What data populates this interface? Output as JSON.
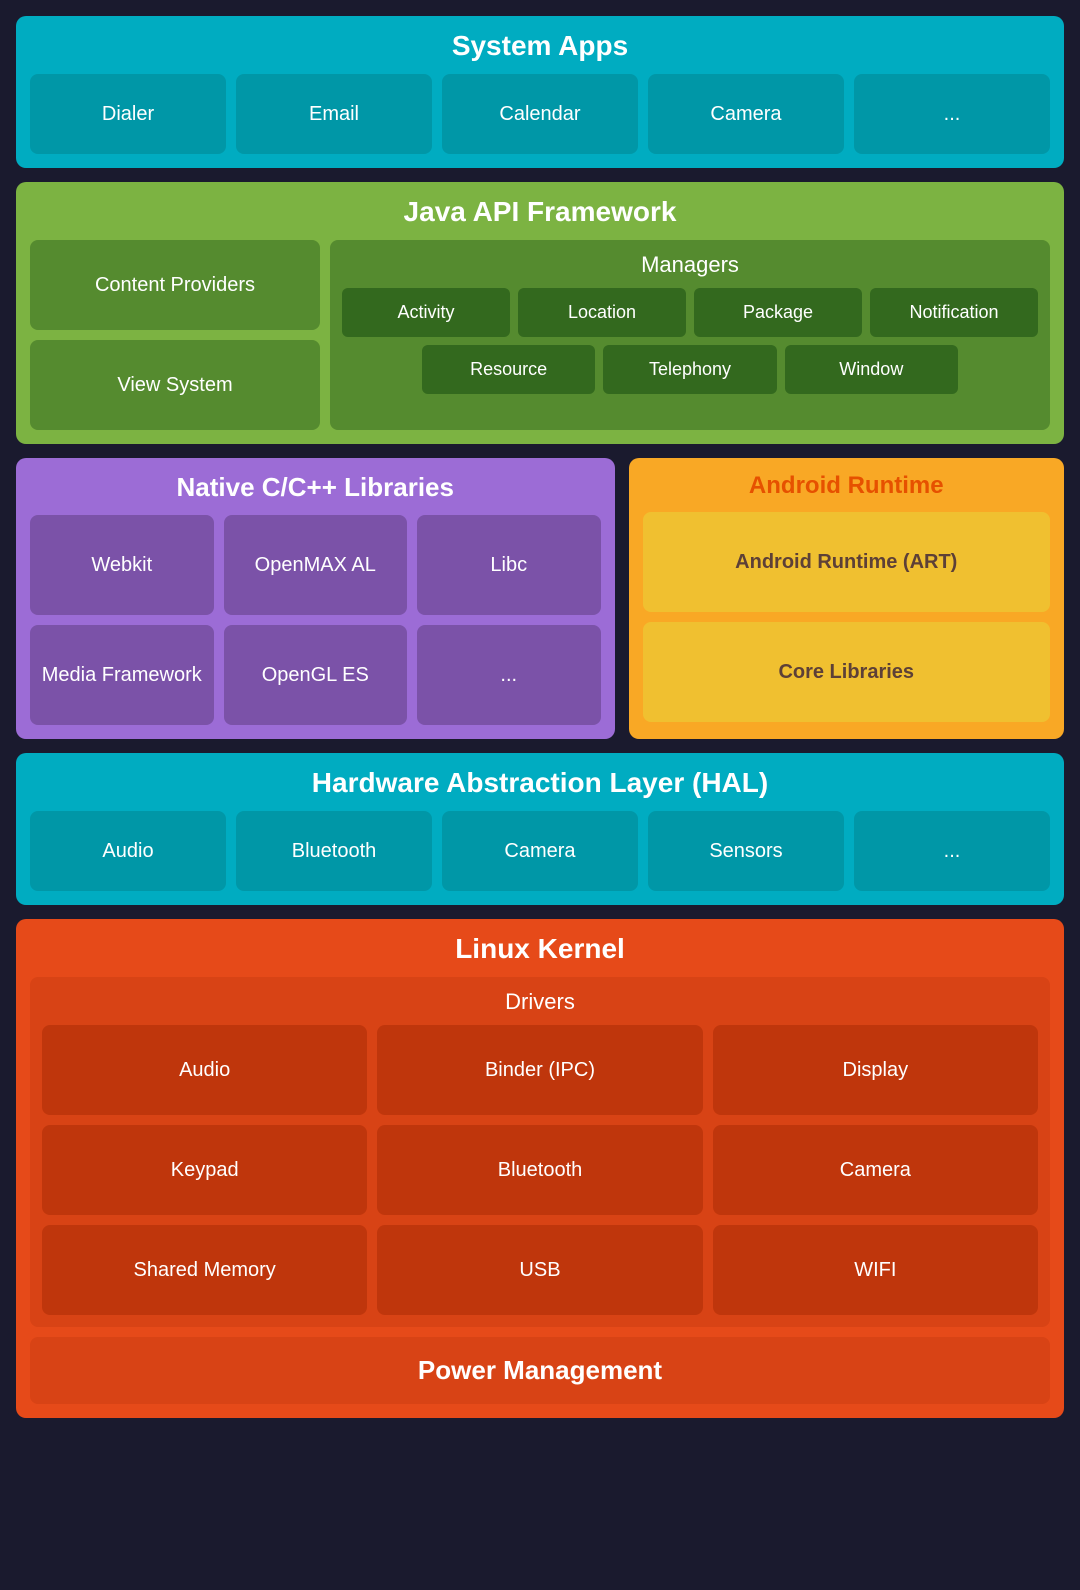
{
  "system_apps": {
    "title": "System Apps",
    "cells": [
      "Dialer",
      "Email",
      "Calendar",
      "Camera",
      "..."
    ]
  },
  "java_api": {
    "title": "Java API Framework",
    "left_cells": [
      "Content Providers",
      "View System"
    ],
    "managers_title": "Managers",
    "managers_row1": [
      "Activity",
      "Location",
      "Package",
      "Notification"
    ],
    "managers_row2": [
      "Resource",
      "Telephony",
      "Window"
    ]
  },
  "native_cpp": {
    "title": "Native C/C++ Libraries",
    "cells": [
      "Webkit",
      "OpenMAX AL",
      "Libc",
      "Media Framework",
      "OpenGL ES",
      "..."
    ]
  },
  "android_runtime": {
    "title": "Android Runtime",
    "cells": [
      "Android Runtime (ART)",
      "Core Libraries"
    ]
  },
  "hal": {
    "title": "Hardware Abstraction Layer (HAL)",
    "cells": [
      "Audio",
      "Bluetooth",
      "Camera",
      "Sensors",
      "..."
    ]
  },
  "linux_kernel": {
    "title": "Linux Kernel",
    "drivers_title": "Drivers",
    "drivers": [
      "Audio",
      "Binder (IPC)",
      "Display",
      "Keypad",
      "Bluetooth",
      "Camera",
      "Shared Memory",
      "USB",
      "WIFI"
    ],
    "power_management": "Power Management"
  }
}
